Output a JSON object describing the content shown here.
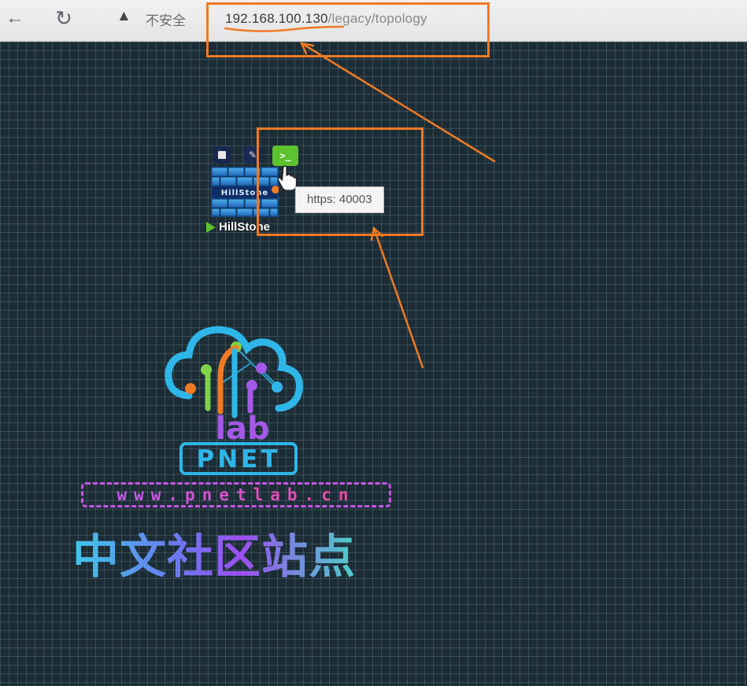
{
  "browser": {
    "back_icon": "arrow-left-icon",
    "reload_icon": "reload-icon",
    "warning_icon": "warning-triangle-icon",
    "security_label": "不安全",
    "address_host": "192.168.100.130",
    "address_path": "/legacy/topology"
  },
  "node": {
    "name": "HillStone",
    "device_label": "HillStone",
    "status": "running",
    "toolbar": {
      "stop_icon": "stop-square-icon",
      "edit_icon": "edit-icon",
      "console_label": ">_"
    },
    "tooltip": "https: 40003"
  },
  "logo": {
    "lab_text": "lab",
    "brand": "PNET",
    "website": "www.pnetlab.cn",
    "community": "中文社区站点"
  },
  "colors": {
    "accent_orange": "#f07a23",
    "console_green": "#5dc22e",
    "grid_bg": "#1d2d36"
  }
}
